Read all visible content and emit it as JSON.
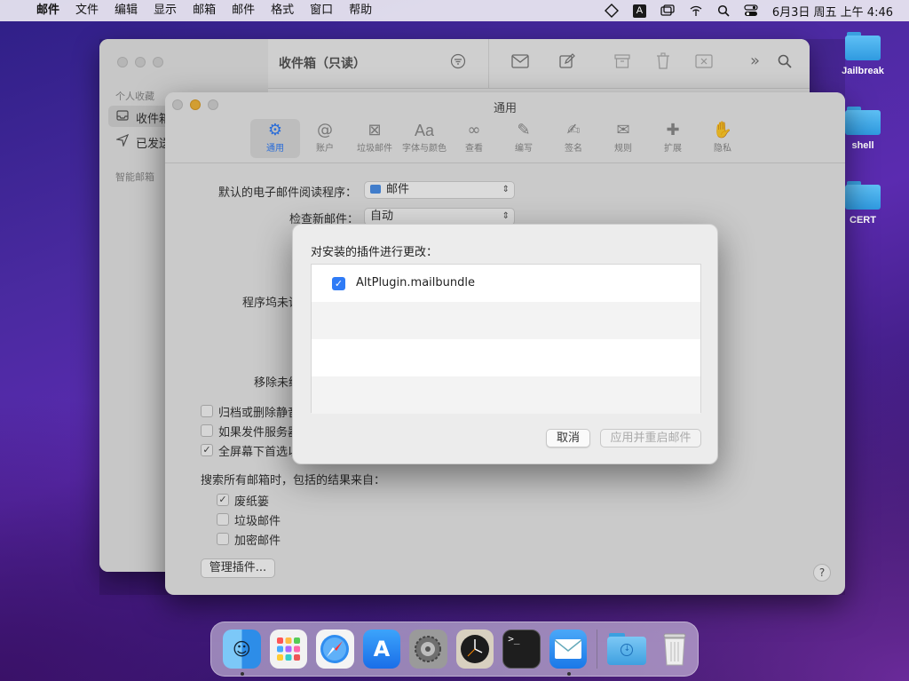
{
  "menubar": {
    "app": "邮件",
    "items": [
      "文件",
      "编辑",
      "显示",
      "邮箱",
      "邮件",
      "格式",
      "窗口",
      "帮助"
    ],
    "input_indicator": "A",
    "clock": "6月3日 周五 上午 4:46"
  },
  "desktop": {
    "icons": [
      "Jailbreak",
      "shell",
      "CERT"
    ]
  },
  "mail_window": {
    "title": "收件箱（只读）",
    "sidebar_section": "个人收藏",
    "sidebar_items": [
      "收件箱",
      "已发送"
    ],
    "smart_section": "智能邮箱"
  },
  "prefs": {
    "title": "通用",
    "tabs": [
      "通用",
      "账户",
      "垃圾邮件",
      "字体与颜色",
      "查看",
      "编写",
      "签名",
      "规则",
      "扩展",
      "隐私"
    ],
    "tab_icons": [
      "gear-icon",
      "at-icon",
      "junk-icon",
      "font-icon",
      "glasses-icon",
      "compose-icon",
      "signature-icon",
      "rules-icon",
      "puzzle-icon",
      "hand-icon"
    ],
    "default_reader_label": "默认的电子邮件阅读程序：",
    "default_reader_value": "邮件",
    "check_label": "检查新邮件：",
    "check_value": "自动",
    "dock_label": "程序坞未读",
    "remove_label": "移除未编",
    "cb1": "归档或删除静音",
    "cb2": "如果发件服务器",
    "cb3": "全屏幕下首选以",
    "search_label": "搜索所有邮箱时，包括的结果来自：",
    "search_opts": [
      "废纸篓",
      "垃圾邮件",
      "加密邮件"
    ],
    "manage_btn": "管理插件...",
    "help": "?"
  },
  "sheet": {
    "title": "对安装的插件进行更改：",
    "plugins": [
      "AltPlugin.mailbundle"
    ],
    "cancel": "取消",
    "apply": "应用并重启邮件"
  },
  "dock": {
    "apps": [
      "Finder",
      "Launchpad",
      "Safari",
      "App Store",
      "System Preferences",
      "Clock",
      "Terminal",
      "Mail",
      "Downloads",
      "Trash"
    ]
  }
}
